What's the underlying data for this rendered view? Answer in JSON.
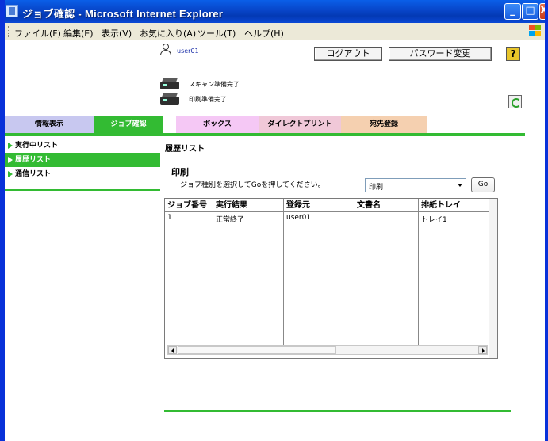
{
  "window": {
    "title": "ジョブ確認 - Microsoft Internet Explorer",
    "buttons": {
      "minimize": "_",
      "maximize": "□",
      "close": "X"
    }
  },
  "menubar": {
    "items": [
      "ファイル(F)",
      "編集(E)",
      "表示(V)",
      "お気に入り(A)",
      "ツール(T)",
      "ヘルプ(H)"
    ]
  },
  "header": {
    "user_name": "user01",
    "logout_label": "ログアウト",
    "password_change_label": "パスワード変更",
    "help_label": "?"
  },
  "status": {
    "scan_ready": "スキャン準備完了",
    "print_ready": "印刷準備完了"
  },
  "tabs": [
    {
      "label": "情報表示",
      "color": "#c8c8f0"
    },
    {
      "label": "ジョブ確認",
      "color": "#33bb33"
    },
    {
      "label": "ボックス",
      "color": "#f5c8f5"
    },
    {
      "label": "ダイレクトプリント",
      "color": "#f0c8d8"
    },
    {
      "label": "宛先登録",
      "color": "#f5d0b0"
    }
  ],
  "sidebar": {
    "items": [
      {
        "label": "実行中リスト",
        "active": false
      },
      {
        "label": "履歴リスト",
        "active": true
      },
      {
        "label": "通信リスト",
        "active": false
      }
    ]
  },
  "main": {
    "title": "履歴リスト",
    "section_title": "印刷",
    "instruction": "ジョブ種別を選択してGoを押してください。",
    "job_type_select": {
      "value": "印刷"
    },
    "go_label": "Go",
    "table": {
      "headers": [
        "ジョブ番号",
        "実行結果",
        "登録元",
        "文書名",
        "排紙トレイ"
      ],
      "rows": [
        [
          "1",
          "正常終了",
          "user01",
          "",
          "トレイ1"
        ]
      ]
    }
  },
  "colors": {
    "accent_green": "#33bb33",
    "titlebar_blue": "#0a48d6"
  }
}
